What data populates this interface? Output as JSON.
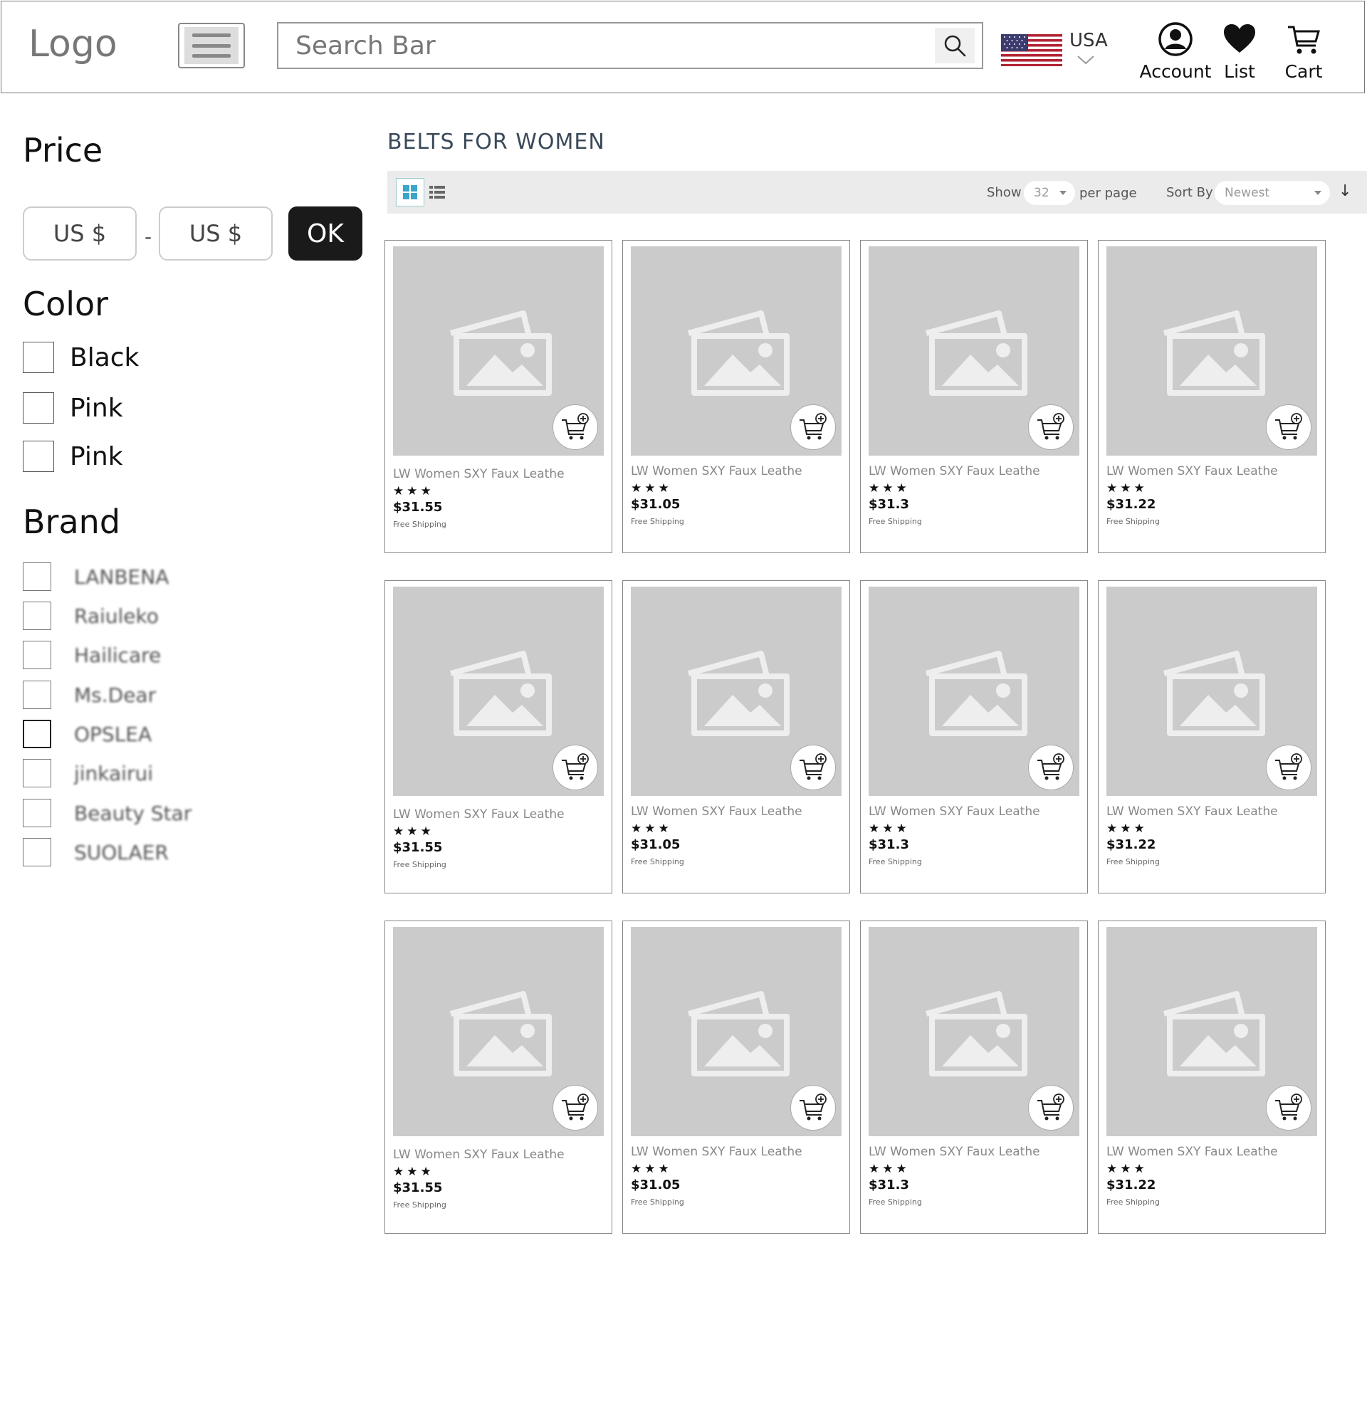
{
  "header": {
    "logo": "Logo",
    "search_placeholder": "Search Bar",
    "country": "USA",
    "account_label": "Account",
    "list_label": "List",
    "cart_label": "Cart"
  },
  "filters": {
    "price_title": "Price",
    "price_min_placeholder": "US $",
    "price_max_placeholder": "US $",
    "price_separator": "-",
    "ok_label": "OK",
    "color_title": "Color",
    "colors": [
      "Black",
      "Pink",
      "Pink"
    ],
    "brand_title": "Brand",
    "brands": [
      "LANBENA",
      "Raiuleko",
      "Hailicare",
      "Ms.Dear",
      "OPSLEA",
      "jinkairui",
      "Beauty Star",
      "SUOLAER"
    ]
  },
  "listing": {
    "title": "BELTS FOR WOMEN",
    "show_label": "Show",
    "per_page_value": "32",
    "per_page_label": "per page",
    "sort_label": "Sort By",
    "sort_value": "Newest",
    "sort_direction_icon": "↓"
  },
  "products": [
    {
      "title": "LW Women SXY Faux Leathe",
      "stars": "★★★",
      "price": "$31.55",
      "shipping": "Free Shipping"
    },
    {
      "title": "LW Women SXY Faux Leathe",
      "stars": "★★★",
      "price": "$31.05",
      "shipping": "Free Shipping"
    },
    {
      "title": "LW Women SXY Faux Leathe",
      "stars": "★★★",
      "price": "$31.3",
      "shipping": "Free Shipping"
    },
    {
      "title": "LW Women SXY Faux Leathe",
      "stars": "★★★",
      "price": "$31.22",
      "shipping": "Free Shipping"
    },
    {
      "title": "LW Women SXY Faux Leathe",
      "stars": "★★★",
      "price": "$31.55",
      "shipping": "Free Shipping"
    },
    {
      "title": "LW Women SXY Faux Leathe",
      "stars": "★★★",
      "price": "$31.05",
      "shipping": "Free Shipping"
    },
    {
      "title": "LW Women SXY Faux Leathe",
      "stars": "★★★",
      "price": "$31.3",
      "shipping": "Free Shipping"
    },
    {
      "title": "LW Women SXY Faux Leathe",
      "stars": "★★★",
      "price": "$31.22",
      "shipping": "Free Shipping"
    },
    {
      "title": "LW Women SXY Faux Leathe",
      "stars": "★★★",
      "price": "$31.55",
      "shipping": "Free Shipping"
    },
    {
      "title": "LW Women SXY Faux Leathe",
      "stars": "★★★",
      "price": "$31.05",
      "shipping": "Free Shipping"
    },
    {
      "title": "LW Women SXY Faux Leathe",
      "stars": "★★★",
      "price": "$31.3",
      "shipping": "Free Shipping"
    },
    {
      "title": "LW Women SXY Faux Leathe",
      "stars": "★★★",
      "price": "$31.22",
      "shipping": "Free Shipping"
    }
  ],
  "icons": {
    "menu": "hamburger-menu-icon",
    "search": "search-icon",
    "flag": "usa-flag-icon",
    "account": "account-icon",
    "list": "heart-icon",
    "cart": "cart-icon",
    "add_to_cart": "add-to-cart-icon",
    "product_image": "image-placeholder-icon"
  },
  "colors": {
    "ok_button_bg": "#1a1a1a",
    "toolbar_bg": "#ebebeb",
    "image_placeholder_bg": "#cbcbcb",
    "grid_view_active": "#3aa6c9"
  }
}
